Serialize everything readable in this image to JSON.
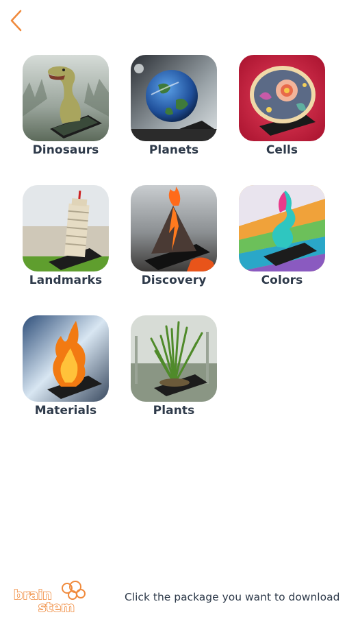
{
  "nav": {
    "back_icon": "chevron-left-icon"
  },
  "packages": [
    {
      "label": "Dinosaurs"
    },
    {
      "label": "Planets"
    },
    {
      "label": "Cells"
    },
    {
      "label": "Landmarks"
    },
    {
      "label": "Discovery"
    },
    {
      "label": "Colors"
    },
    {
      "label": "Materials"
    },
    {
      "label": "Plants"
    }
  ],
  "footer": {
    "logo_word_top": "brain",
    "logo_word_bottom": "stem",
    "instruction": "Click the package you want to download"
  },
  "colors": {
    "accent": "#f08a3c",
    "label": "#2e3a4a",
    "background": "#ffffff"
  }
}
